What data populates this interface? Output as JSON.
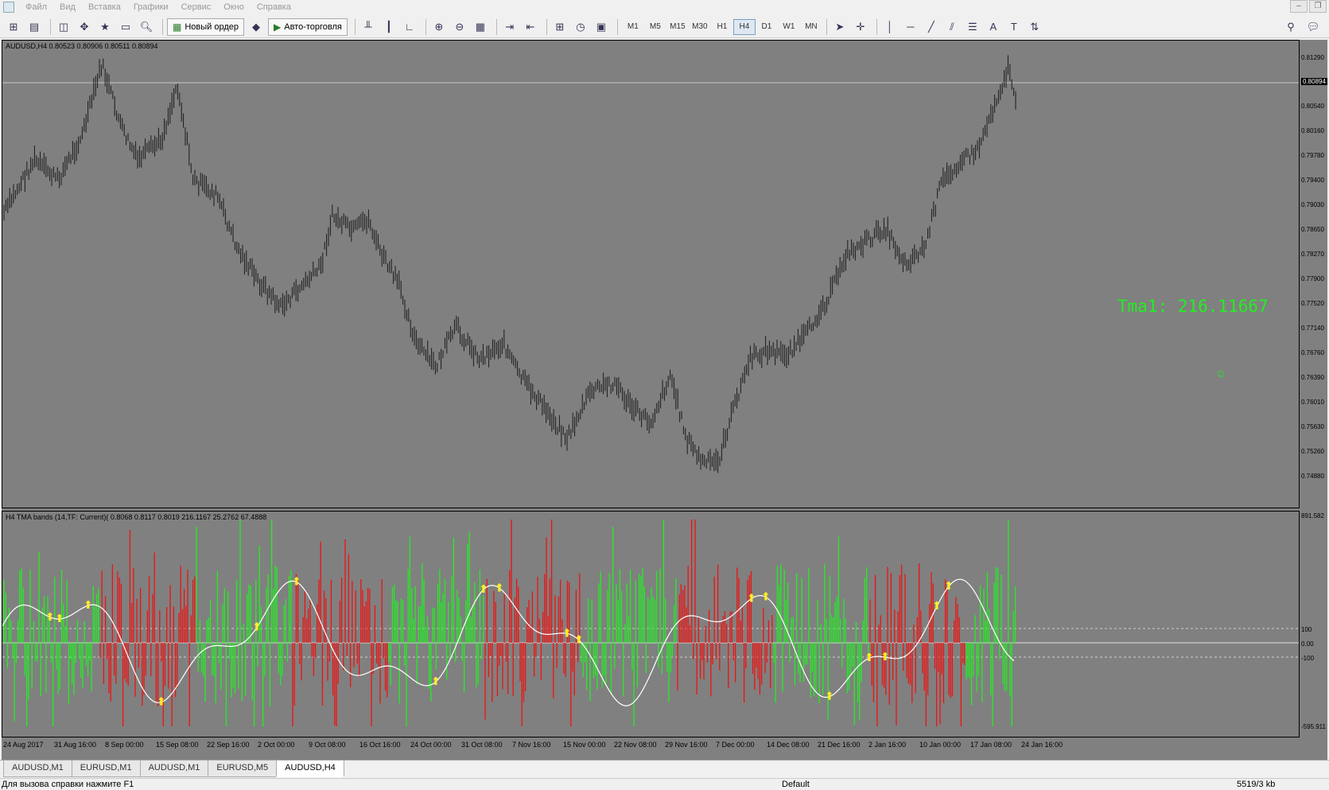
{
  "menu": [
    "Файл",
    "Вид",
    "Вставка",
    "Графики",
    "Сервис",
    "Окно",
    "Справка"
  ],
  "toolbar": {
    "new_order": "Новый ордер",
    "auto_trading": "Авто-торговля",
    "timeframes": [
      "M1",
      "M5",
      "M15",
      "M30",
      "H1",
      "H4",
      "D1",
      "W1",
      "MN"
    ],
    "active_timeframe": "H4"
  },
  "price_pane": {
    "title": "AUDUSD,H4  0.80523 0.80906 0.80511 0.80894",
    "current_price": "0.80894",
    "price_labels": [
      "0.81290",
      "0.80540",
      "0.80160",
      "0.79780",
      "0.79400",
      "0.79030",
      "0.78650",
      "0.78270",
      "0.77900",
      "0.77520",
      "0.77140",
      "0.76760",
      "0.76390",
      "0.76010",
      "0.75630",
      "0.75260",
      "0.74880"
    ]
  },
  "indicator_pane": {
    "title": "H4 TMA bands (14,TF: Current)( 0.8068 0.8117 0.8019 216.1167 25.2762 67.4888",
    "labels": [
      "891.582",
      "100",
      "0.00",
      "-100",
      "-595.911"
    ]
  },
  "tma_text": "Tma1:  216.11667",
  "smiley": "☺",
  "time_labels": [
    "24 Aug 2017",
    "31 Aug 16:00",
    "8 Sep 00:00",
    "15 Sep 08:00",
    "22 Sep 16:00",
    "2 Oct 00:00",
    "9 Oct 08:00",
    "16 Oct 16:00",
    "24 Oct 00:00",
    "31 Oct 08:00",
    "7 Nov 16:00",
    "15 Nov 00:00",
    "22 Nov 08:00",
    "29 Nov 16:00",
    "7 Dec 00:00",
    "14 Dec 08:00",
    "21 Dec 16:00",
    "2 Jan 16:00",
    "10 Jan 00:00",
    "17 Jan 08:00",
    "24 Jan 16:00"
  ],
  "tabs": [
    "AUDUSD,M1",
    "EURUSD,M1",
    "AUDUSD,M1",
    "EURUSD,M5",
    "AUDUSD,H4"
  ],
  "active_tab": 4,
  "status": {
    "help": "Для вызова справки нажмите F1",
    "profile": "Default",
    "traffic": "5519/3 kb"
  },
  "colors": {
    "background": "#808080",
    "candles": "#1a1a1a",
    "bull": "#22ee22",
    "bear": "#ee1111",
    "tma_line": "#ffffff",
    "arrows": "#ffee22"
  }
}
